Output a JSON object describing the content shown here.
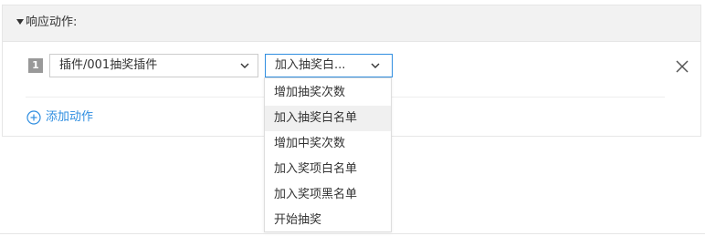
{
  "header": {
    "title": "响应动作:"
  },
  "action_row": {
    "index": "1",
    "plugin_select": {
      "value": "插件/001抽奖插件"
    },
    "action_select": {
      "value": "加入抽奖白..."
    }
  },
  "add_action": {
    "label": "添加动作"
  },
  "dropdown": {
    "options": [
      "增加抽奖次数",
      "加入抽奖白名单",
      "增加中奖次数",
      "加入奖项白名单",
      "加入奖项黑名单",
      "开始抽奖"
    ],
    "highlighted": "加入抽奖白名单"
  },
  "colors": {
    "accent": "#2f8ee0",
    "header_bg": "#f2f2f2",
    "index_badge": "#999999"
  },
  "icons": {
    "collapse": "triangle-down-icon",
    "chevron": "chevron-down-icon",
    "close": "close-icon",
    "add": "plus-circle-icon"
  }
}
